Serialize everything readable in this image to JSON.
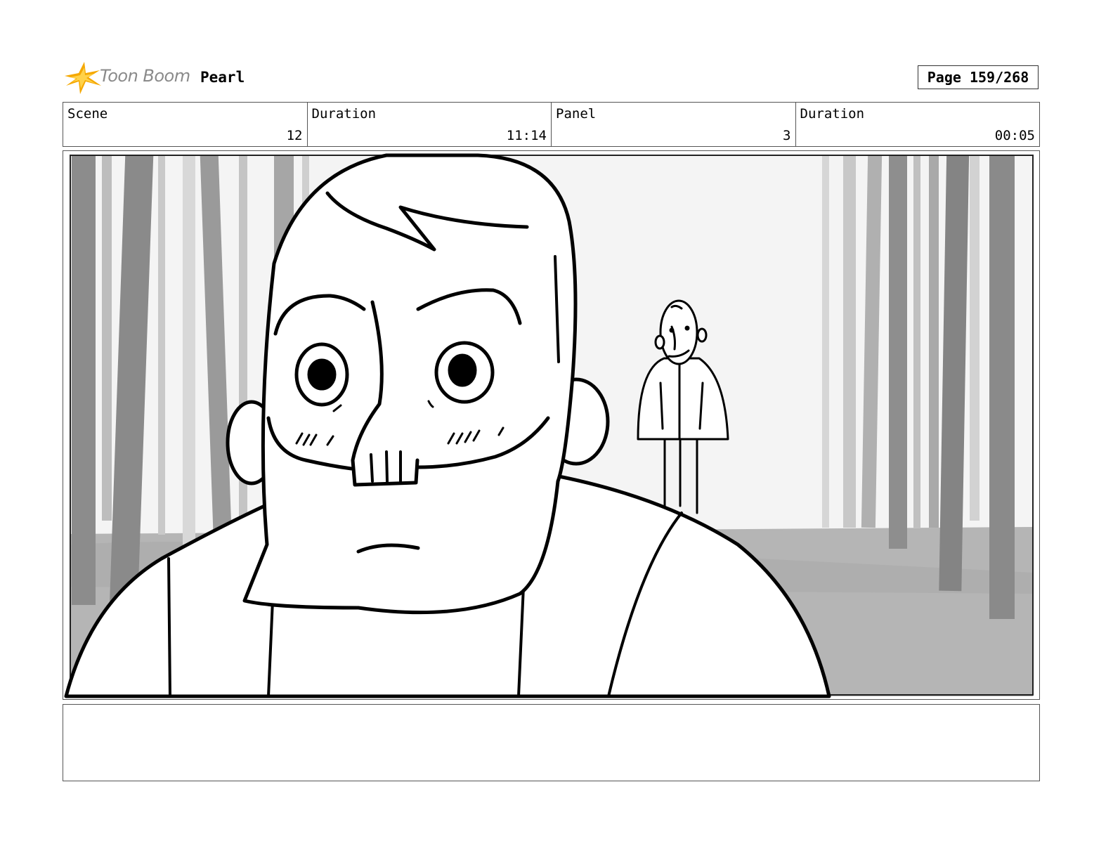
{
  "header": {
    "logo_text": "Toon Boom",
    "project_title": "Pearl",
    "page_label": "Page 159/268"
  },
  "info": {
    "scene_label": "Scene",
    "scene_value": "12",
    "scene_duration_label": "Duration",
    "scene_duration_value": "11:14",
    "panel_label": "Panel",
    "panel_value": "3",
    "panel_duration_label": "Duration",
    "panel_duration_value": "00:05"
  },
  "notes": {
    "text": ""
  },
  "colors": {
    "logo_orange": "#f5a800",
    "tree_dark": "#8a8a8a",
    "tree_light": "#c8c8c8",
    "ground": "#b4b4b4"
  }
}
